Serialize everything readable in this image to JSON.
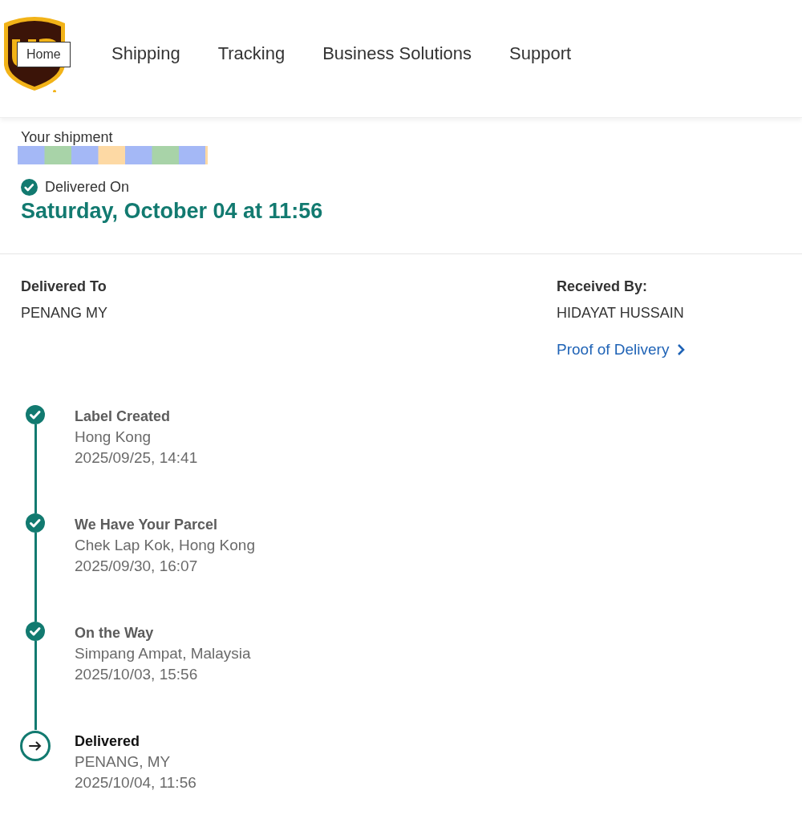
{
  "header": {
    "logo_tooltip": "Home",
    "nav": [
      "Shipping",
      "Tracking",
      "Business Solutions",
      "Support"
    ]
  },
  "shipment": {
    "label": "Your shipment",
    "status": "Delivered On",
    "date": "Saturday, October 04 at 11:56"
  },
  "delivered_to": {
    "label": "Delivered To",
    "value": "PENANG MY"
  },
  "received_by": {
    "label": "Received By:",
    "value": "HIDAYAT HUSSAIN",
    "link": "Proof of Delivery"
  },
  "timeline": [
    {
      "title": "Label Created",
      "location": "Hong Kong",
      "time": "2025/09/25, 14:41",
      "completed": true
    },
    {
      "title": "We Have Your Parcel",
      "location": "Chek Lap Kok, Hong Kong",
      "time": "2025/09/30, 16:07",
      "completed": true
    },
    {
      "title": "On the Way",
      "location": "Simpang Ampat, Malaysia",
      "time": "2025/10/03, 15:56",
      "completed": true
    },
    {
      "title": "Delivered",
      "location": "PENANG, MY",
      "time": "2025/10/04, 11:56",
      "completed": false
    }
  ]
}
